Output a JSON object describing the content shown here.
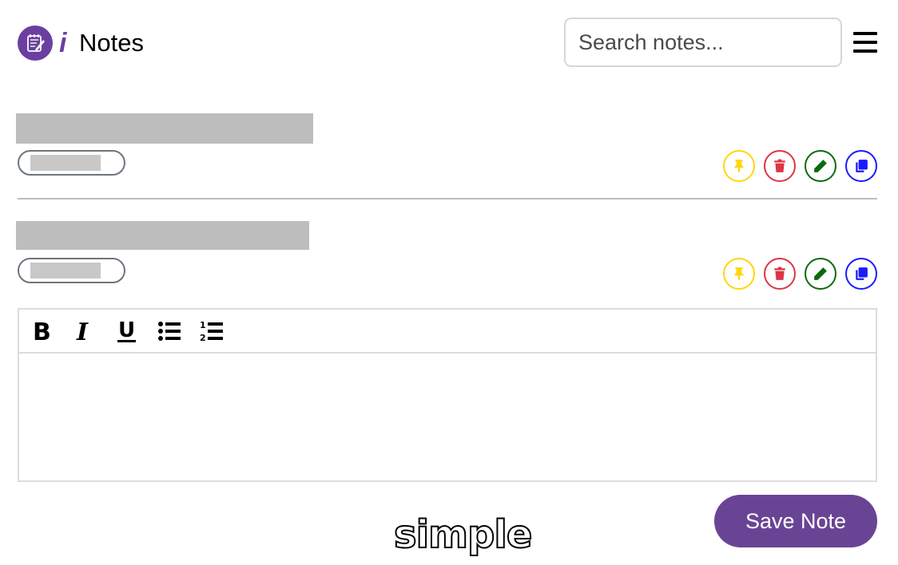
{
  "header": {
    "logo_icon": "notepad-icon",
    "brand_letter": "i",
    "title": "Notes",
    "search_placeholder": "Search notes...",
    "menu_icon": "hamburger-menu-icon"
  },
  "notes": [
    {
      "title": "",
      "tag": "",
      "actions": [
        {
          "name": "pin",
          "icon": "pin-icon",
          "color": "#ffd60a"
        },
        {
          "name": "delete",
          "icon": "trash-icon",
          "color": "#dc3545"
        },
        {
          "name": "edit",
          "icon": "pencil-icon",
          "color": "#0b6a0b"
        },
        {
          "name": "copy",
          "icon": "copy-icon",
          "color": "#1a1aff"
        }
      ]
    },
    {
      "title": "",
      "tag": "",
      "actions": [
        {
          "name": "pin",
          "icon": "pin-icon",
          "color": "#ffd60a"
        },
        {
          "name": "delete",
          "icon": "trash-icon",
          "color": "#dc3545"
        },
        {
          "name": "edit",
          "icon": "pencil-icon",
          "color": "#0b6a0b"
        },
        {
          "name": "copy",
          "icon": "copy-icon",
          "color": "#1a1aff"
        }
      ]
    }
  ],
  "editor": {
    "toolbar": [
      "bold-icon",
      "italic-icon",
      "underline-icon",
      "bullet-list-icon",
      "numbered-list-icon"
    ],
    "content": ""
  },
  "save_label": "Save Note",
  "footer_word": "simple",
  "colors": {
    "accent": "#6a4494",
    "pin": "#ffd60a",
    "delete": "#dc3545",
    "edit": "#0b6a0b",
    "copy": "#1a1aff"
  }
}
